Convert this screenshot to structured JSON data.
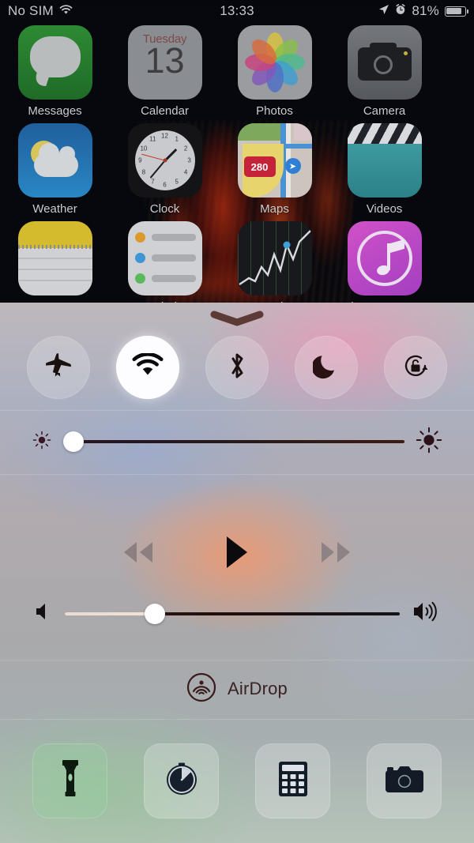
{
  "status_bar": {
    "carrier": "No SIM",
    "wifi_icon": "wifi-icon",
    "time": "13:33",
    "location_icon": "location-arrow-icon",
    "alarm_icon": "alarm-clock-icon",
    "battery_percent": "81%",
    "battery_icon": "battery-icon",
    "battery_level": 76
  },
  "home_screen": {
    "apps": [
      {
        "label": "Messages",
        "icon": "messages-icon"
      },
      {
        "label": "Calendar",
        "icon": "calendar-icon",
        "day": "Tuesday",
        "date": "13"
      },
      {
        "label": "Photos",
        "icon": "photos-icon"
      },
      {
        "label": "Camera",
        "icon": "camera-icon"
      },
      {
        "label": "Weather",
        "icon": "weather-icon"
      },
      {
        "label": "Clock",
        "icon": "clock-icon"
      },
      {
        "label": "Maps",
        "icon": "maps-icon",
        "highway": "280"
      },
      {
        "label": "Videos",
        "icon": "videos-icon"
      },
      {
        "label": "Notes",
        "icon": "notes-icon"
      },
      {
        "label": "Reminders",
        "icon": "reminders-icon"
      },
      {
        "label": "Stocks",
        "icon": "stocks-icon"
      },
      {
        "label": "iTunes Store",
        "icon": "itunes-store-icon"
      }
    ]
  },
  "control_center": {
    "grabber": "grabber-handle",
    "toggles": [
      {
        "name": "airplane-mode",
        "icon": "airplane-icon",
        "active": false
      },
      {
        "name": "wifi",
        "icon": "wifi-icon",
        "active": true
      },
      {
        "name": "bluetooth",
        "icon": "bluetooth-icon",
        "active": false
      },
      {
        "name": "do-not-disturb",
        "icon": "moon-icon",
        "active": false
      },
      {
        "name": "rotation-lock",
        "icon": "rotation-lock-icon",
        "active": false
      }
    ],
    "brightness": {
      "low_icon": "brightness-low-icon",
      "high_icon": "brightness-high-icon",
      "value": 3
    },
    "media": {
      "previous_icon": "rewind-icon",
      "play_icon": "play-icon",
      "next_icon": "fast-forward-icon",
      "playing": false
    },
    "volume": {
      "mute_icon": "speaker-mute-icon",
      "loud_icon": "speaker-loud-icon",
      "value": 27
    },
    "airdrop": {
      "label": "AirDrop",
      "icon": "airdrop-icon"
    },
    "shortcuts": [
      {
        "name": "flashlight",
        "icon": "flashlight-icon",
        "active": true
      },
      {
        "name": "timer",
        "icon": "timer-icon",
        "active": false
      },
      {
        "name": "calculator",
        "icon": "calculator-icon",
        "active": false
      },
      {
        "name": "camera",
        "icon": "camera-icon",
        "active": false
      }
    ]
  },
  "colors": {
    "accent_active": "#ffffff",
    "icon_dark": "#1b1016",
    "icon_muted": "#8b7f80",
    "flashlight_tile": "#8fc49a"
  }
}
